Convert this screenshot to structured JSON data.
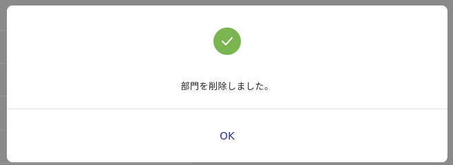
{
  "dialog": {
    "icon": "check-circle-icon",
    "message": "部門を削除しました。",
    "ok_label": "OK"
  },
  "colors": {
    "success": "#7ab552",
    "button_text": "#2d3a8c",
    "overlay": "#8a8a8a"
  }
}
